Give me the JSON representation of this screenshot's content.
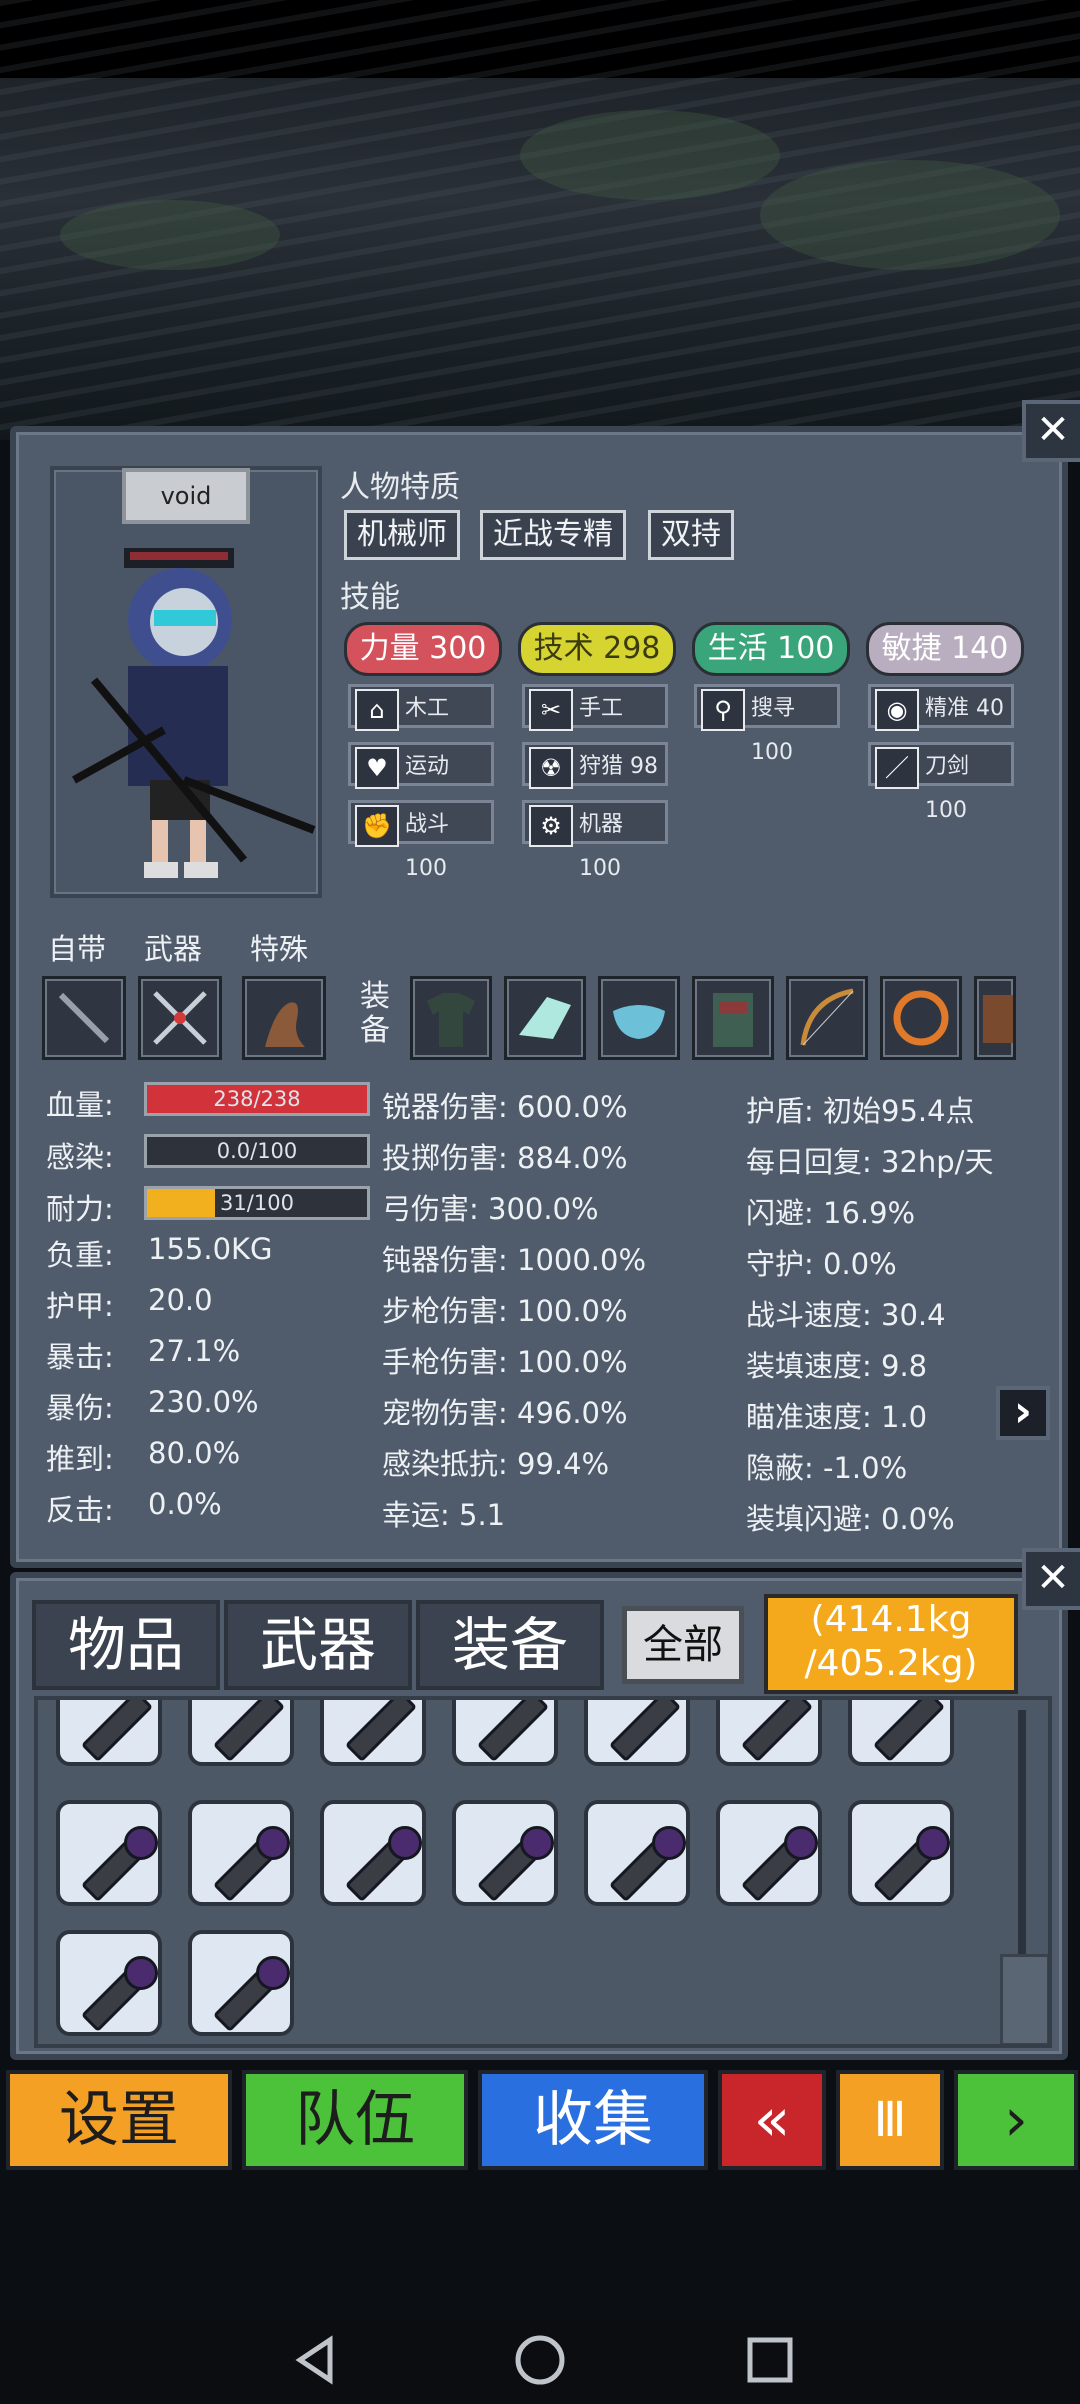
{
  "character": {
    "name": "void",
    "traits_title": "人物特质",
    "traits": [
      "机械师",
      "近战专精",
      "双持"
    ],
    "skills_title": "技能",
    "attributes": [
      {
        "label": "力量 300",
        "color": "#d4525c"
      },
      {
        "label": "技术 298",
        "color": "#d6d431"
      },
      {
        "label": "生活 100",
        "color": "#3aa57a"
      },
      {
        "label": "敏捷 140",
        "color": "#b9aec0"
      }
    ],
    "skills": [
      {
        "label": "木工 100",
        "icon": "house-icon",
        "glyph": "⌂"
      },
      {
        "label": "手工 100",
        "icon": "scissors-icon",
        "glyph": "✂"
      },
      {
        "label": "搜寻 100",
        "icon": "magnifier-icon",
        "glyph": "⚲"
      },
      {
        "label": "精准 40",
        "icon": "eye-icon",
        "glyph": "◉"
      },
      {
        "label": "运动 100",
        "icon": "heart-icon",
        "glyph": "♥"
      },
      {
        "label": "狩猎 98",
        "icon": "radiation-icon",
        "glyph": "☢"
      },
      {
        "label": "刀剑 100",
        "icon": "sword-icon",
        "glyph": "／"
      },
      {
        "label": "战斗 100",
        "icon": "fist-icon",
        "glyph": "✊"
      },
      {
        "label": "机器 100",
        "icon": "gear-icon",
        "glyph": "⚙"
      }
    ]
  },
  "loadout": {
    "labels": [
      "自带",
      "武器",
      "特殊"
    ],
    "equip_label": "装备",
    "slot_icons": [
      "dagger-icon",
      "dual-blades-icon",
      "ferret-pet-icon"
    ],
    "equip_icons": [
      "shirt-icon",
      "crystal-shard-icon",
      "face-mask-icon",
      "armor-vest-icon",
      "bow-icon",
      "ring-icon",
      "barrel-icon"
    ]
  },
  "stats": {
    "col1": [
      {
        "label": "血量:",
        "bar": "238/238",
        "fraction": 1.0,
        "color": "#d2323a"
      },
      {
        "label": "感染:",
        "bar": "0.0/100",
        "fraction": 0.0,
        "color": "#d2323a"
      },
      {
        "label": "耐力:",
        "bar": "31/100",
        "fraction": 0.31,
        "color": "#f2b01e"
      },
      {
        "label": "负重:",
        "value": "155.0KG"
      },
      {
        "label": "护甲:",
        "value": "20.0"
      },
      {
        "label": "暴击:",
        "value": "27.1%"
      },
      {
        "label": "暴伤:",
        "value": "230.0%"
      },
      {
        "label": "推到:",
        "value": "80.0%"
      },
      {
        "label": "反击:",
        "value": "0.0%"
      }
    ],
    "col2": [
      "锐器伤害: 600.0%",
      "投掷伤害: 884.0%",
      "弓伤害: 300.0%",
      "钝器伤害: 1000.0%",
      "步枪伤害: 100.0%",
      "手枪伤害: 100.0%",
      "宠物伤害: 496.0%",
      "感染抵抗: 99.4%",
      "幸运: 5.1"
    ],
    "col3": [
      "护盾: 初始95.4点",
      "每日回复: 32hp/天",
      "闪避: 16.9%",
      "守护: 0.0%",
      "战斗速度: 30.4",
      "装填速度: 9.8",
      "瞄准速度: 1.0",
      "隐蔽: -1.0%",
      "装填闪避: 0.0%"
    ]
  },
  "inventory": {
    "tabs": [
      "物品",
      "武器",
      "装备"
    ],
    "filter": "全部",
    "weight_line1": "(414.1kg",
    "weight_line2": "/405.2kg)"
  },
  "bottom_buttons": {
    "settings": "设置",
    "team": "队伍",
    "collect": "收集",
    "back": "«",
    "pause": "Ⅲ",
    "forward": "›"
  },
  "icons": {
    "close": "✕",
    "next": "›"
  }
}
